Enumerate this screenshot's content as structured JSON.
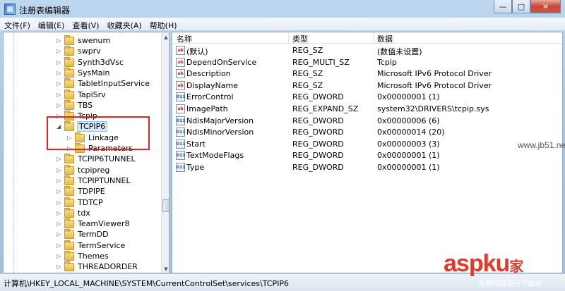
{
  "window": {
    "title": "注册表编辑器",
    "minimize_glyph": "—",
    "maximize_glyph": "□",
    "close_glyph": "✕"
  },
  "menu": [
    "文件(F)",
    "编辑(E)",
    "查看(V)",
    "收藏夹(A)",
    "帮助(H)"
  ],
  "tree": {
    "items": [
      {
        "label": "swenum",
        "level": 1,
        "expanded": false
      },
      {
        "label": "swprv",
        "level": 1,
        "expanded": false
      },
      {
        "label": "Synth3dVsc",
        "level": 1,
        "expanded": false
      },
      {
        "label": "SysMain",
        "level": 1,
        "expanded": false
      },
      {
        "label": "TabletInputService",
        "level": 1,
        "expanded": false
      },
      {
        "label": "TapiSrv",
        "level": 1,
        "expanded": false
      },
      {
        "label": "TBS",
        "level": 1,
        "expanded": false
      },
      {
        "label": "Tcpip",
        "level": 1,
        "expanded": false
      },
      {
        "label": "TCPIP6",
        "level": 1,
        "expanded": true,
        "selected": true
      },
      {
        "label": "Linkage",
        "level": 2,
        "expanded": false
      },
      {
        "label": "Parameters",
        "level": 2,
        "expanded": false
      },
      {
        "label": "TCPIP6TUNNEL",
        "level": 1,
        "expanded": false
      },
      {
        "label": "tcpipreg",
        "level": 1,
        "expanded": false
      },
      {
        "label": "TCPIPTUNNEL",
        "level": 1,
        "expanded": false
      },
      {
        "label": "TDPIPE",
        "level": 1,
        "expanded": false
      },
      {
        "label": "TDTCP",
        "level": 1,
        "expanded": false
      },
      {
        "label": "tdx",
        "level": 1,
        "expanded": false
      },
      {
        "label": "TeamViewer8",
        "level": 1,
        "expanded": false
      },
      {
        "label": "TermDD",
        "level": 1,
        "expanded": false
      },
      {
        "label": "TermService",
        "level": 1,
        "expanded": false
      },
      {
        "label": "Themes",
        "level": 1,
        "expanded": false
      },
      {
        "label": "THREADORDER",
        "level": 1,
        "expanded": false
      }
    ]
  },
  "list": {
    "columns": [
      "名称",
      "类型",
      "数据"
    ],
    "rows": [
      {
        "icon": "string-value-icon",
        "name": "(默认)",
        "type": "REG_SZ",
        "data": "(数值未设置)"
      },
      {
        "icon": "string-value-icon",
        "name": "DependOnService",
        "type": "REG_MULTI_SZ",
        "data": "Tcpip"
      },
      {
        "icon": "string-value-icon",
        "name": "Description",
        "type": "REG_SZ",
        "data": "Microsoft IPv6 Protocol Driver"
      },
      {
        "icon": "string-value-icon",
        "name": "DisplayName",
        "type": "REG_SZ",
        "data": "Microsoft IPv6 Protocol Driver"
      },
      {
        "icon": "dword-value-icon",
        "name": "ErrorControl",
        "type": "REG_DWORD",
        "data": "0x00000001 (1)"
      },
      {
        "icon": "string-value-icon",
        "name": "ImagePath",
        "type": "REG_EXPAND_SZ",
        "data": "system32\\DRIVERS\\tcpip.sys"
      },
      {
        "icon": "dword-value-icon",
        "name": "NdisMajorVersion",
        "type": "REG_DWORD",
        "data": "0x00000006 (6)"
      },
      {
        "icon": "dword-value-icon",
        "name": "NdisMinorVersion",
        "type": "REG_DWORD",
        "data": "0x00000014 (20)"
      },
      {
        "icon": "dword-value-icon",
        "name": "Start",
        "type": "REG_DWORD",
        "data": "0x00000003 (3)"
      },
      {
        "icon": "dword-value-icon",
        "name": "TextModeFlags",
        "type": "REG_DWORD",
        "data": "0x00000001 (1)"
      },
      {
        "icon": "dword-value-icon",
        "name": "Type",
        "type": "REG_DWORD",
        "data": "0x00000001 (1)"
      }
    ]
  },
  "status": "计算机\\HKEY_LOCAL_MACHINE\\SYSTEM\\CurrentControlSet\\services\\TCPIP6",
  "watermarks": {
    "jb51": "www.jb51.net",
    "asp": "asp",
    "ku": "ku",
    "jia": "家",
    "sub": "免费网站源码下载站"
  },
  "colors": {
    "highlight_box": "#e0242a",
    "selection": "#d6e7f8"
  }
}
